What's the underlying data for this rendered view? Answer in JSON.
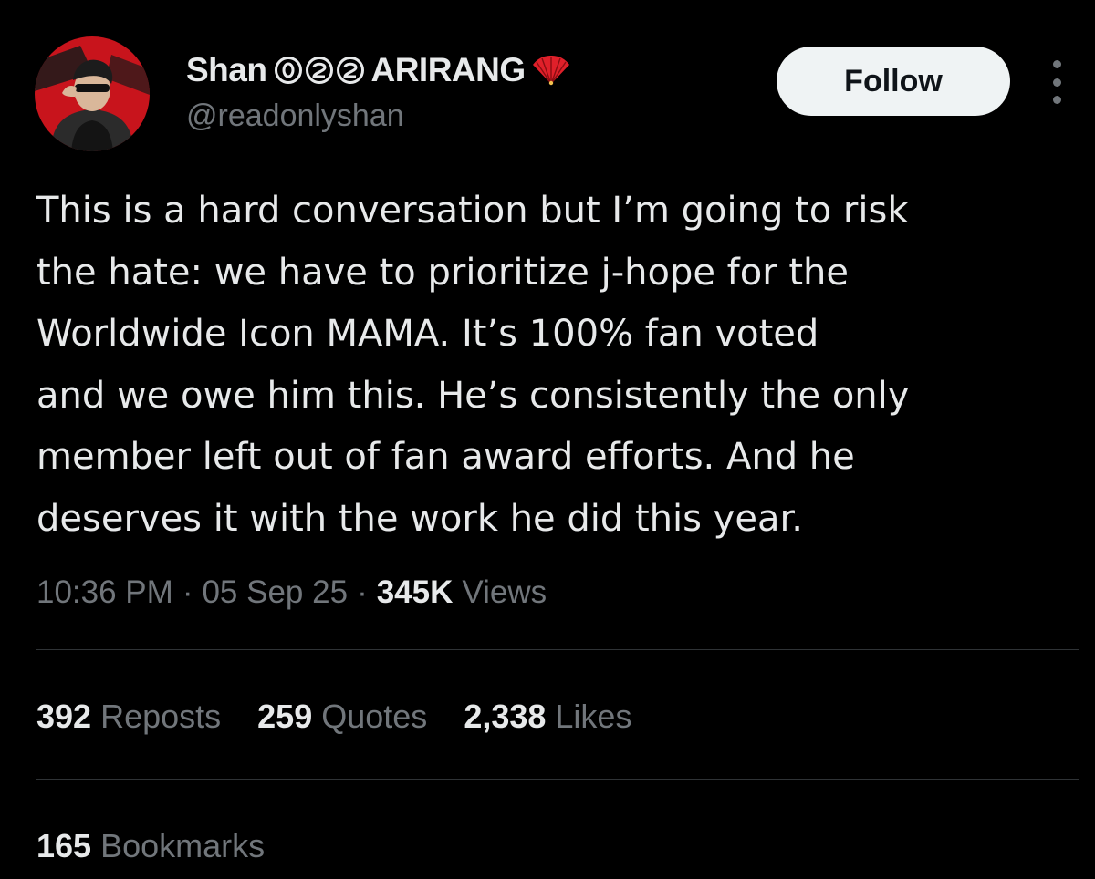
{
  "author": {
    "display_name": "Shan",
    "name_suffix": "ARIRANG",
    "badge_glyphs": [
      "⓪",
      "⓶",
      "⓶"
    ],
    "badge_icons": [
      "circled-zero-icon",
      "circled-two-icon",
      "circled-two-icon"
    ],
    "emoji_icon": "red-folding-fan-icon",
    "handle": "@readonlyshan",
    "avatar_icon": "profile-photo-avatar"
  },
  "actions": {
    "follow_label": "Follow",
    "more_icon": "vertical-ellipsis-icon"
  },
  "tweet": {
    "lines": [
      "This is a hard conversation but I’m going to risk",
      "the hate: we have to prioritize j-hope for the",
      "Worldwide Icon MAMA. It’s 100% fan voted",
      "and we owe him this. He’s consistently the only",
      "member left out of fan award efforts. And he",
      "deserves it with the work he did this year."
    ]
  },
  "meta": {
    "time": "10:36 PM",
    "separator": "·",
    "date": "05 Sep 25",
    "views_count": "345K",
    "views_label": "Views"
  },
  "stats": {
    "reposts_count": "392",
    "reposts_label": "Reposts",
    "quotes_count": "259",
    "quotes_label": "Quotes",
    "likes_count": "2,338",
    "likes_label": "Likes",
    "bookmarks_count": "165",
    "bookmarks_label": "Bookmarks"
  },
  "colors": {
    "background": "#000000",
    "primary_text": "#e7e9ea",
    "secondary_text": "#71767b",
    "divider": "#2f3336",
    "follow_bg": "#eff3f4",
    "follow_text": "#0f1419",
    "avatar_red": "#c8141c",
    "fan_red": "#e0202a"
  }
}
